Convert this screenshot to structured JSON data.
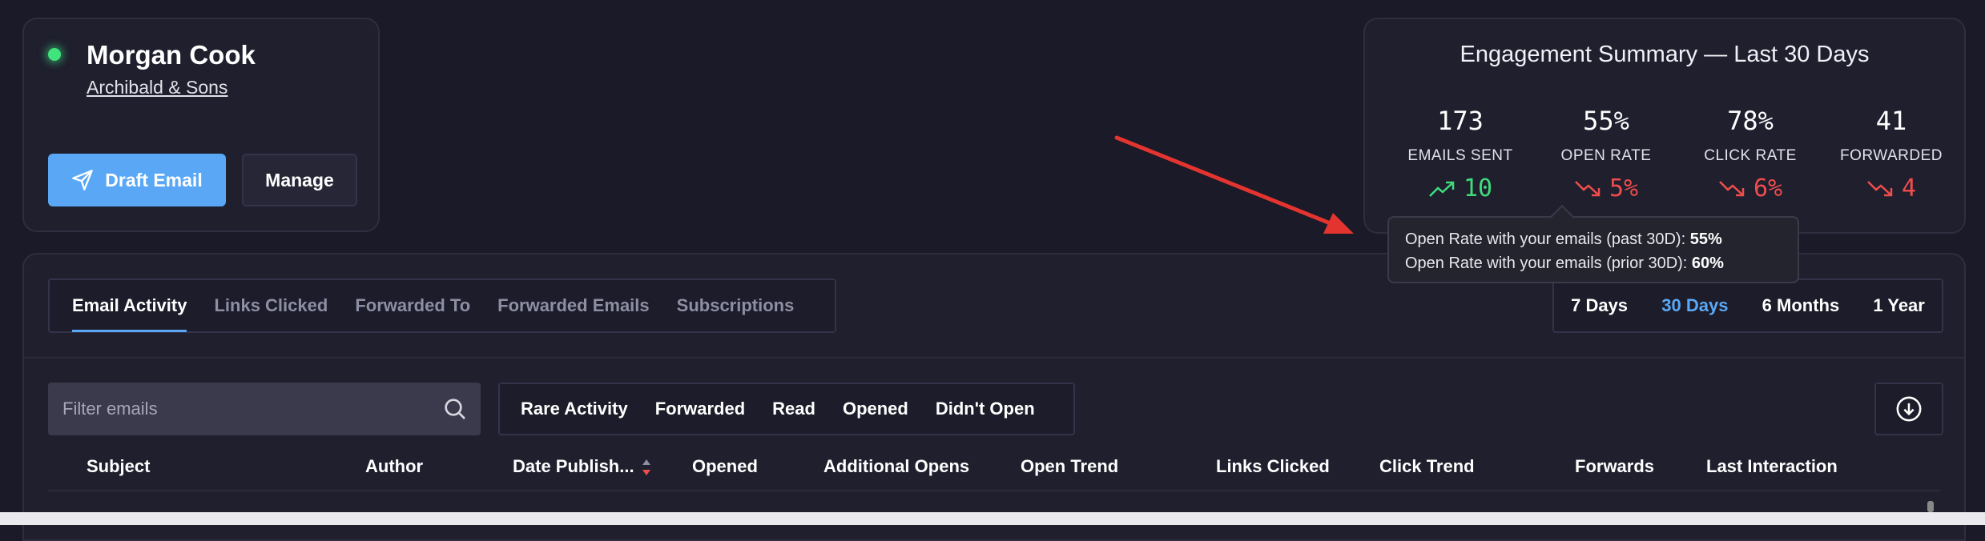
{
  "contact": {
    "name": "Morgan Cook",
    "company": "Archibald & Sons",
    "status_color": "#3fe57c",
    "draft_button": "Draft Email",
    "manage_button": "Manage"
  },
  "summary": {
    "title": "Engagement Summary — Last 30 Days",
    "metrics": [
      {
        "value": "173",
        "label": "EMAILS SENT",
        "delta": "10",
        "trend": "up"
      },
      {
        "value": "55%",
        "label": "OPEN RATE",
        "delta": "5%",
        "trend": "down"
      },
      {
        "value": "78%",
        "label": "CLICK RATE",
        "delta": "6%",
        "trend": "down"
      },
      {
        "value": "41",
        "label": "FORWARDED",
        "delta": "4",
        "trend": "down"
      }
    ]
  },
  "tooltip": {
    "line1_label": "Open Rate with your emails (past 30D):",
    "line1_value": "55%",
    "line2_label": "Open Rate with your emails (prior 30D):",
    "line2_value": "60%"
  },
  "tabs": [
    "Email Activity",
    "Links Clicked",
    "Forwarded To",
    "Forwarded Emails",
    "Subscriptions"
  ],
  "active_tab": "Email Activity",
  "ranges": [
    "7 Days",
    "30 Days",
    "6 Months",
    "1 Year"
  ],
  "selected_range": "30 Days",
  "search": {
    "placeholder": "Filter emails"
  },
  "filters": [
    "Rare Activity",
    "Forwarded",
    "Read",
    "Opened",
    "Didn't Open"
  ],
  "columns": [
    "Subject",
    "Author",
    "Date Publish...",
    "Opened",
    "Additional Opens",
    "Open Trend",
    "Links Clicked",
    "Click Trend",
    "Forwards",
    "Last Interaction"
  ],
  "colors": {
    "accent": "#5aa8f5",
    "positive": "#3fdc7a",
    "negative": "#ef4d4d",
    "annotation_arrow": "#e3342f"
  },
  "icons": {
    "draft": "paper-plane-icon",
    "search": "search-icon",
    "download": "download-circle-icon",
    "sort": "sort-icon"
  }
}
